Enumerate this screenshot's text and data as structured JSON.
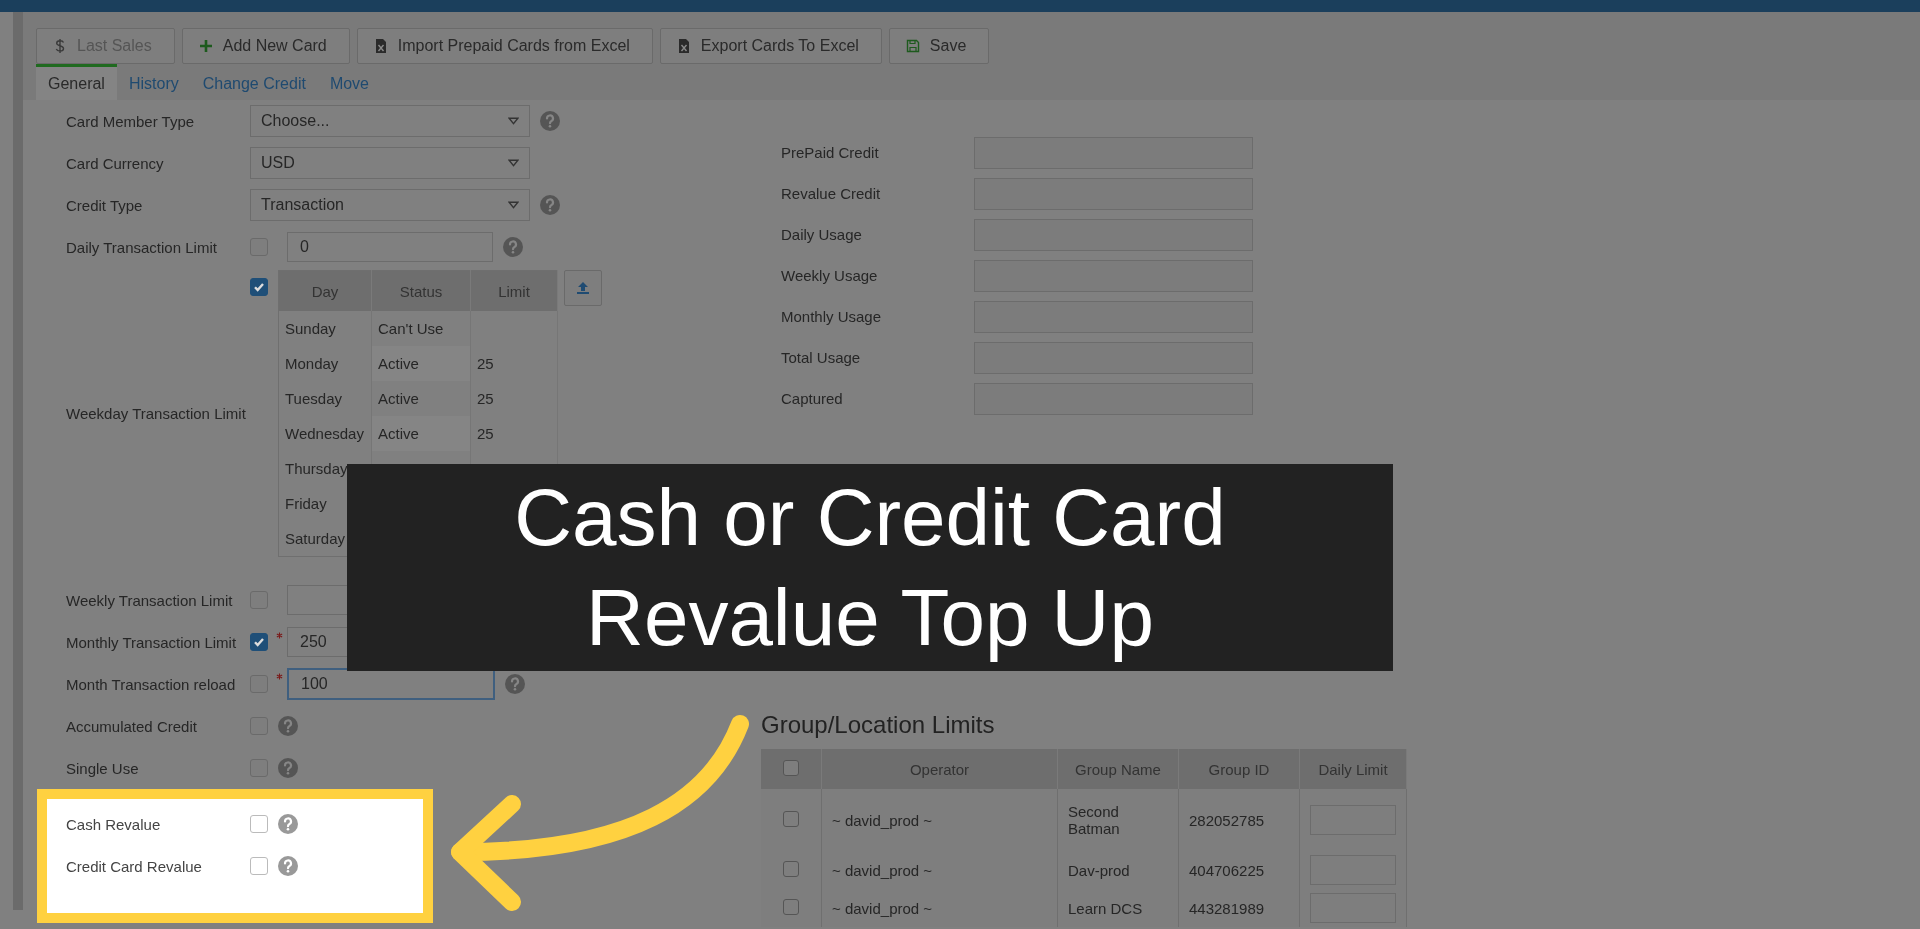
{
  "toolbar": {
    "buttons": [
      {
        "label": "Last Sales",
        "kind": "dollar",
        "disabled": true
      },
      {
        "label": "Add New Card",
        "kind": "plus",
        "disabled": false
      },
      {
        "label": "Import Prepaid Cards from Excel",
        "kind": "excel",
        "disabled": false
      },
      {
        "label": "Export Cards To Excel",
        "kind": "excel",
        "disabled": false
      },
      {
        "label": "Save",
        "kind": "save",
        "disabled": false
      }
    ]
  },
  "tabs": [
    {
      "label": "General",
      "selected": true
    },
    {
      "label": "History",
      "selected": false
    },
    {
      "label": "Change Credit",
      "selected": false
    },
    {
      "label": "Move",
      "selected": false
    }
  ],
  "form": {
    "rows": [
      {
        "kind": "select",
        "label": "Card Member Type",
        "value": "Choose...",
        "help": true
      },
      {
        "kind": "select",
        "label": "Card Currency",
        "value": "USD",
        "help": false
      },
      {
        "kind": "select",
        "label": "Credit Type",
        "value": "Transaction",
        "help": true
      },
      {
        "kind": "check-input",
        "label": "Daily Transaction Limit",
        "checked": false,
        "required": false,
        "value": "0",
        "focused": false,
        "help": true
      },
      {
        "kind": "weekday",
        "label": "Weekday Transaction Limit",
        "checked": true,
        "columns": [
          "Day",
          "Status",
          "Limit"
        ],
        "rows": [
          {
            "day": "Sunday",
            "status": "Can't Use"
          },
          {
            "day": "Monday",
            "status": "Active",
            "limit": "25"
          },
          {
            "day": "Tuesday",
            "status": "Active",
            "limit": "25"
          },
          {
            "day": "Wednesday",
            "status": "Active",
            "limit": "25"
          },
          {
            "day": "Thursday"
          },
          {
            "day": "Friday"
          },
          {
            "day": "Saturday"
          }
        ]
      },
      {
        "kind": "check-input",
        "label": "Weekly Transaction Limit",
        "checked": false,
        "required": false,
        "focused": false,
        "help": false
      },
      {
        "kind": "check-input",
        "label": "Monthly Transaction Limit",
        "checked": true,
        "required": true,
        "value": "250",
        "focused": false,
        "help": false
      },
      {
        "kind": "check-input",
        "label": "Month Transaction reload",
        "checked": false,
        "required": true,
        "value": "100",
        "focused": true,
        "help": true
      },
      {
        "kind": "check",
        "label": "Accumulated Credit",
        "checked": false,
        "help": true
      },
      {
        "kind": "check",
        "label": "Single Use",
        "checked": false,
        "help": true
      }
    ],
    "highlighted_rows": [
      {
        "kind": "check",
        "label": "Cash Revalue",
        "checked": false,
        "help": true
      },
      {
        "kind": "check",
        "label": "Credit Card Revalue",
        "checked": false,
        "help": true
      }
    ]
  },
  "credit_fields": [
    "PrePaid Credit",
    "Revalue Credit",
    "Daily Usage",
    "Weekly Usage",
    "Monthly Usage",
    "Total Usage",
    "Captured"
  ],
  "group_limits": {
    "title": "Group/Location Limits",
    "header_checked": false,
    "columns": [
      "Operator",
      "Group Name",
      "Group ID",
      "Daily Limit"
    ],
    "rows": [
      {
        "checked": false,
        "operator": "~ david_prod ~",
        "group_name": "Second Batman",
        "group_id": "282052785"
      },
      {
        "checked": false,
        "operator": "~ david_prod ~",
        "group_name": "Dav-prod",
        "group_id": "404706225"
      },
      {
        "checked": false,
        "operator": "~ david_prod ~",
        "group_name": "Learn DCS",
        "group_id": "443281989"
      }
    ]
  },
  "caption": {
    "lines": [
      "Cash or Credit Card",
      "Revalue Top Up"
    ]
  }
}
